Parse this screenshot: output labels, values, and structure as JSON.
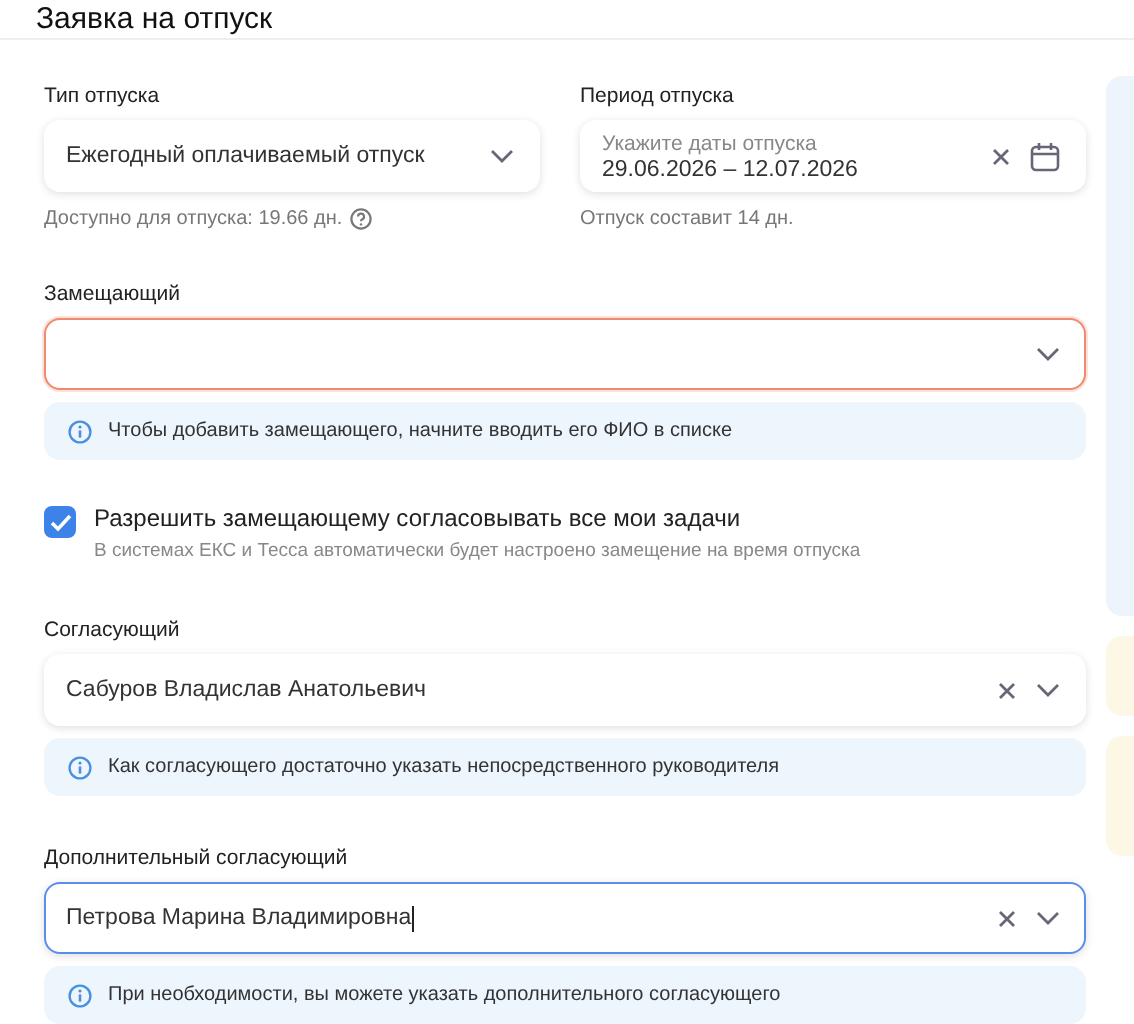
{
  "title": "Заявка на отпуск",
  "top_fields": [
    {
      "kind": "select",
      "label": "Тип отпуска",
      "value": "Ежегодный оплачиваемый отпуск",
      "clearable": false,
      "error": false,
      "focused": false,
      "helper": "Доступно для отпуска: 19.66 дн."
    },
    {
      "kind": "date",
      "label": "Период отпуска",
      "inner_label": "Укажите даты отпуска",
      "value": "29.06.2026 – 12.07.2026",
      "clearable": true,
      "error": false,
      "focused": false,
      "helper": "Отпуск составит 14 дн."
    }
  ],
  "sections": [
    {
      "kind": "field",
      "label": "Замещающий",
      "clearable": false,
      "error": true,
      "focused": false,
      "note": "Чтобы добавить замещающего, начните вводить его ФИО в списке"
    },
    {
      "kind": "checkbox",
      "label": "Разрешить замещающему согласовывать все мои задачи",
      "description": "В системах ЕКС и Тесса автоматически будет настроено замещение на время отпуска",
      "checked": true
    },
    {
      "kind": "field",
      "label": "Согласующий",
      "value": "Сабуров Владислав Анатольевич",
      "clearable": true,
      "error": false,
      "focused": false,
      "note": "Как согласующего достаточно указать непосредственного руководителя"
    },
    {
      "kind": "field",
      "label": "Дополнительный согласующий",
      "value": "Петрова Марина Владимировна",
      "clearable": true,
      "error": false,
      "focused": true,
      "note": "При необходимости, вы можете указать дополнительного согласующего"
    }
  ]
}
